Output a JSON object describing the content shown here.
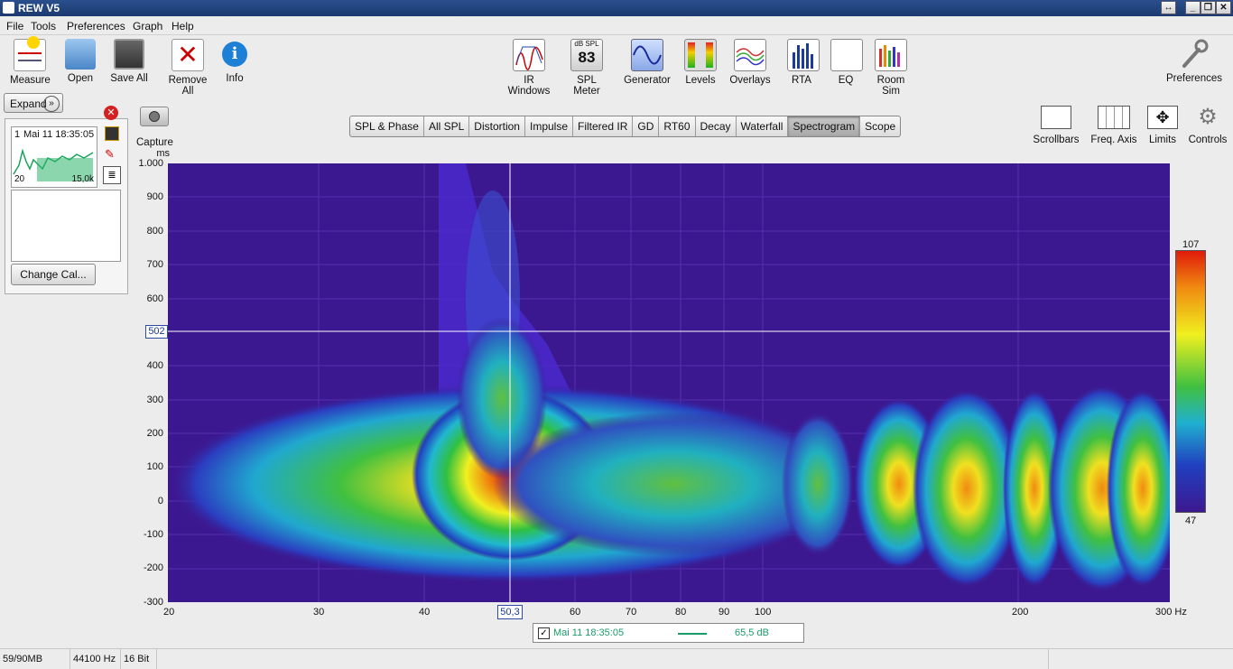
{
  "window": {
    "title": "REW V5"
  },
  "menu": [
    "File",
    "Tools",
    "Preferences",
    "Graph",
    "Help"
  ],
  "toolbar": {
    "measure": "Measure",
    "open": "Open",
    "save_all": "Save All",
    "remove_all": "Remove All",
    "info": "Info",
    "ir_windows": "IR Windows",
    "spl_meter": "SPL Meter",
    "spl_value": "83",
    "spl_unit": "dB SPL",
    "generator": "Generator",
    "levels": "Levels",
    "overlays": "Overlays",
    "rta": "RTA",
    "eq": "EQ",
    "room_sim": "Room Sim",
    "preferences": "Preferences"
  },
  "left_panel": {
    "expand": "Expand",
    "capture": "Capture",
    "measurement_index": "1",
    "measurement_name": "Mai 11 18:35:05",
    "thumb_min": "20",
    "thumb_max": "15,0k",
    "change_cal": "Change Cal..."
  },
  "tabs": [
    "SPL & Phase",
    "All SPL",
    "Distortion",
    "Impulse",
    "Filtered IR",
    "GD",
    "RT60",
    "Decay",
    "Waterfall",
    "Spectrogram",
    "Scope"
  ],
  "active_tab": "Spectrogram",
  "right_tools": {
    "scrollbars": "Scrollbars",
    "freq_axis": "Freq. Axis",
    "limits": "Limits",
    "controls": "Controls"
  },
  "graph": {
    "y_unit": "ms",
    "y_ticks": [
      "1.000",
      "900",
      "800",
      "700",
      "600",
      "400",
      "300",
      "200",
      "100",
      "0",
      "-100",
      "-200",
      "-300"
    ],
    "cursor_y": "502",
    "x_ticks": [
      "20",
      "30",
      "40",
      "60",
      "70",
      "80",
      "90",
      "100",
      "200",
      "300 Hz"
    ],
    "cursor_x": "50,3",
    "scale_max": "107",
    "scale_min": "47"
  },
  "legend": {
    "name": "Mai 11 18:35:05",
    "value": "65,5 dB"
  },
  "status": {
    "memory": "59/90MB",
    "rate": "44100 Hz",
    "bits": "16 Bit"
  }
}
